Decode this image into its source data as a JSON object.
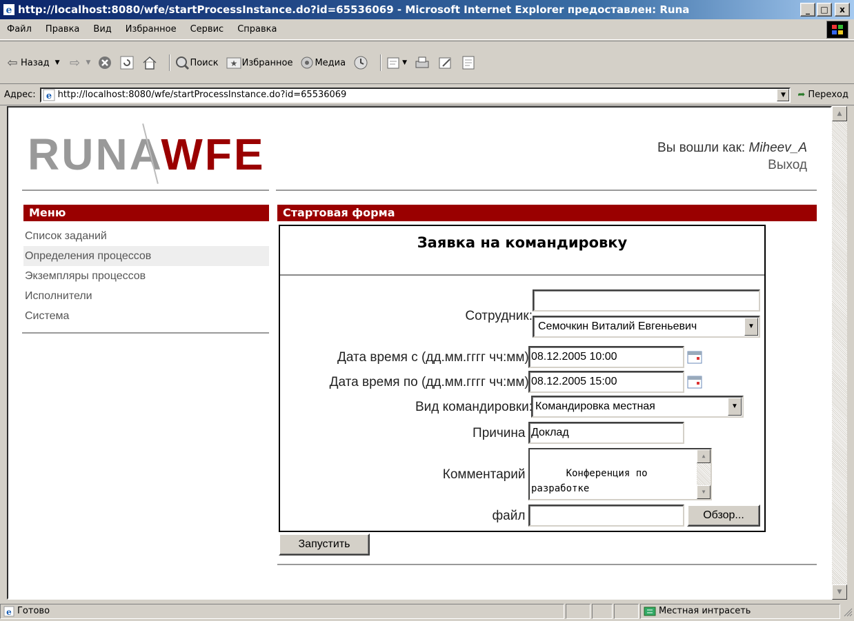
{
  "window": {
    "title": "http://localhost:8080/wfe/startProcessInstance.do?id=65536069 - Microsoft Internet Explorer предоставлен: Runa",
    "minimize": "_",
    "maximize": "□",
    "close": "x"
  },
  "menubar": {
    "items": [
      "Файл",
      "Правка",
      "Вид",
      "Избранное",
      "Сервис",
      "Справка"
    ]
  },
  "toolbar": {
    "back": "Назад",
    "search": "Поиск",
    "favorites": "Избранное",
    "media": "Медиа"
  },
  "address": {
    "label": "Адрес:",
    "url": "http://localhost:8080/wfe/startProcessInstance.do?id=65536069",
    "go": "Переход"
  },
  "page": {
    "logo_runa": "RUNA",
    "logo_wfe": "WFE",
    "login_prefix": "Вы вошли как: ",
    "login_user": "Miheev_A",
    "logout": "Выход",
    "menu_header": "Меню",
    "menu_items": [
      "Список заданий",
      "Определения процессов",
      "Экземпляры процессов",
      "Исполнители",
      "Система"
    ],
    "form_header": "Стартовая форма",
    "form": {
      "title": "Заявка на командировку",
      "employee_label": "Сотрудник:",
      "employee_filter": "",
      "employee_selected": "Семочкин Виталий Евгеньевич",
      "date_from_label": "Дата время с (дд.мм.гггг чч:мм):",
      "date_from_value": "08.12.2005 10:00",
      "date_to_label": "Дата время по (дд.мм.гггг чч:мм):",
      "date_to_value": "08.12.2005 15:00",
      "trip_type_label": "Вид командировки:",
      "trip_type_selected": "Командировка местная",
      "reason_label": "Причина :",
      "reason_value": "Доклад",
      "comment_label": "Комментарий :",
      "comment_value": "Конференция по\nразработке\nOpenSource проектов",
      "file_label": "файл :",
      "file_value": "",
      "browse_button": "Обзор...",
      "submit_button": "Запустить"
    }
  },
  "statusbar": {
    "status": "Готово",
    "zone": "Местная интрасеть"
  },
  "colors": {
    "brand_red": "#9a0000",
    "logo_gray": "#999999",
    "titlebar_blue": "#0a246a"
  }
}
